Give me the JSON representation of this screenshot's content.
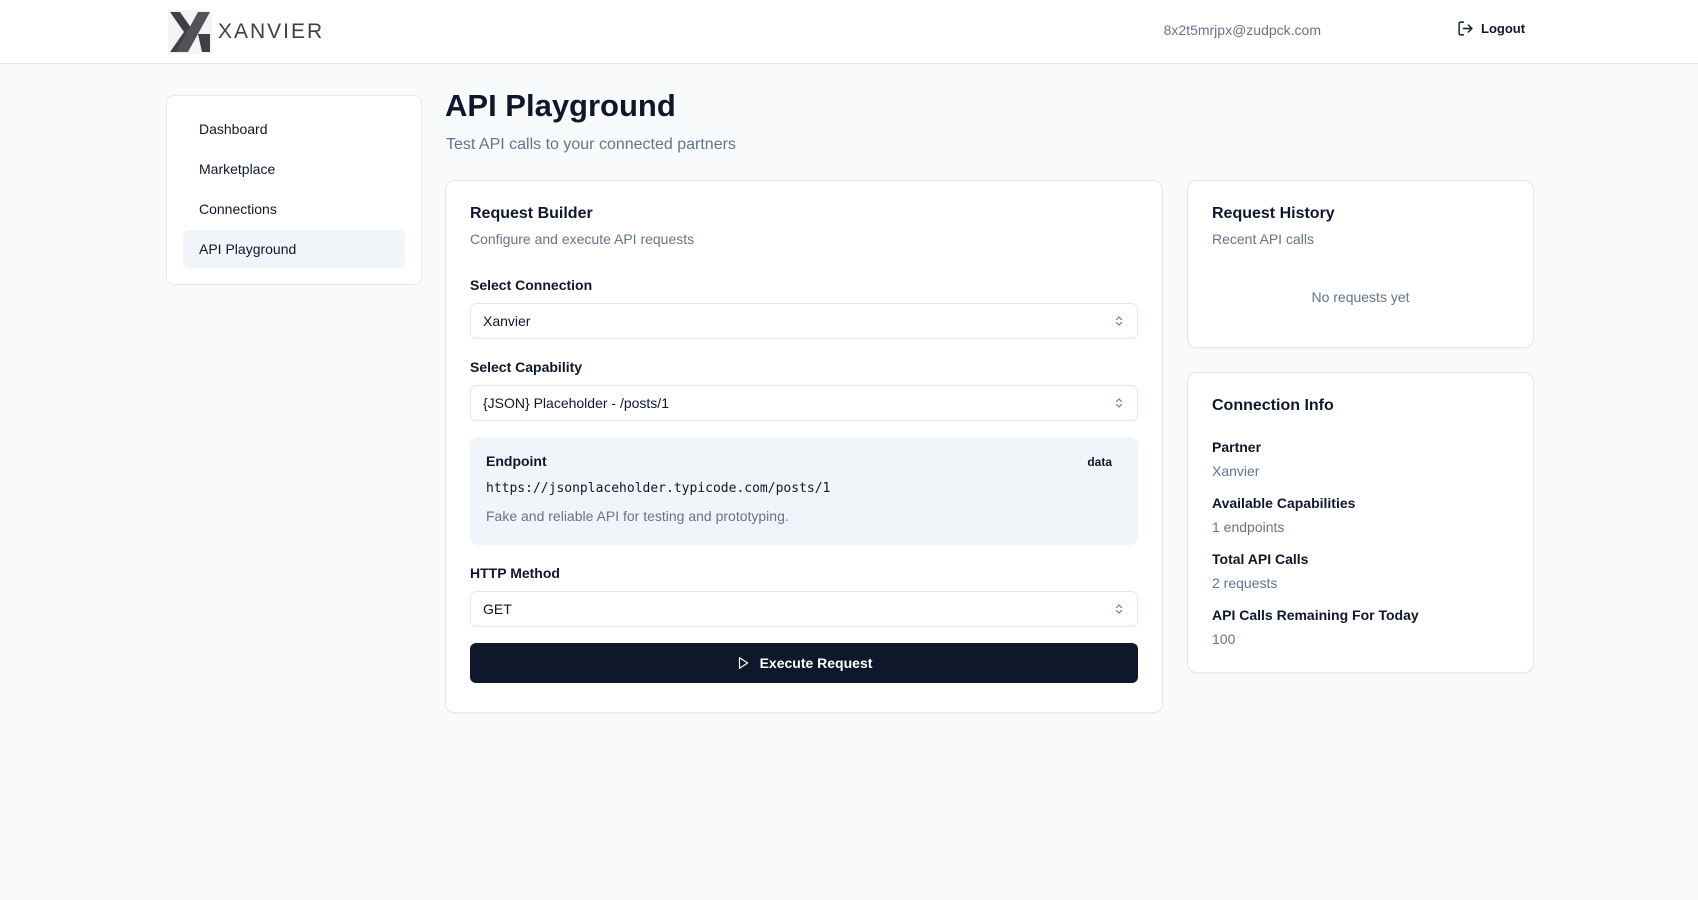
{
  "header": {
    "brand": "XANVIER",
    "user_email": "8x2t5mrjpx@zudpck.com",
    "logout_label": "Logout"
  },
  "sidebar": {
    "items": [
      {
        "label": "Dashboard"
      },
      {
        "label": "Marketplace"
      },
      {
        "label": "Connections"
      },
      {
        "label": "API Playground",
        "active": true
      }
    ]
  },
  "page": {
    "title": "API Playground",
    "subtitle": "Test API calls to your connected partners"
  },
  "request_builder": {
    "title": "Request Builder",
    "description": "Configure and execute API requests",
    "connection_label": "Select Connection",
    "connection_value": "Xanvier",
    "capability_label": "Select Capability",
    "capability_value": "{JSON} Placeholder - /posts/1",
    "endpoint": {
      "title": "Endpoint",
      "badge": "data",
      "url": "https://jsonplaceholder.typicode.com/posts/1",
      "description": "Fake and reliable API for testing and prototyping."
    },
    "method_label": "HTTP Method",
    "method_value": "GET",
    "execute_label": "Execute Request"
  },
  "history": {
    "title": "Request History",
    "description": "Recent API calls",
    "empty_message": "No requests yet"
  },
  "connection_info": {
    "title": "Connection Info",
    "partner_label": "Partner",
    "partner_value": "Xanvier",
    "capabilities_label": "Available Capabilities",
    "capabilities_value": "1 endpoints",
    "total_calls_label": "Total API Calls",
    "total_calls_value": "2 requests",
    "remaining_label": "API Calls Remaining For Today",
    "remaining_value": "100"
  },
  "colors": {
    "primary": "#0f172a",
    "muted_text": "#64748b",
    "background": "#f8fafc",
    "active_nav": "#f1f5f9"
  },
  "icons": {
    "logo": "xanvier-logo-icon",
    "logout": "logout-icon",
    "select_chevrons": "chevrons-up-down-icon",
    "execute": "play-icon"
  }
}
